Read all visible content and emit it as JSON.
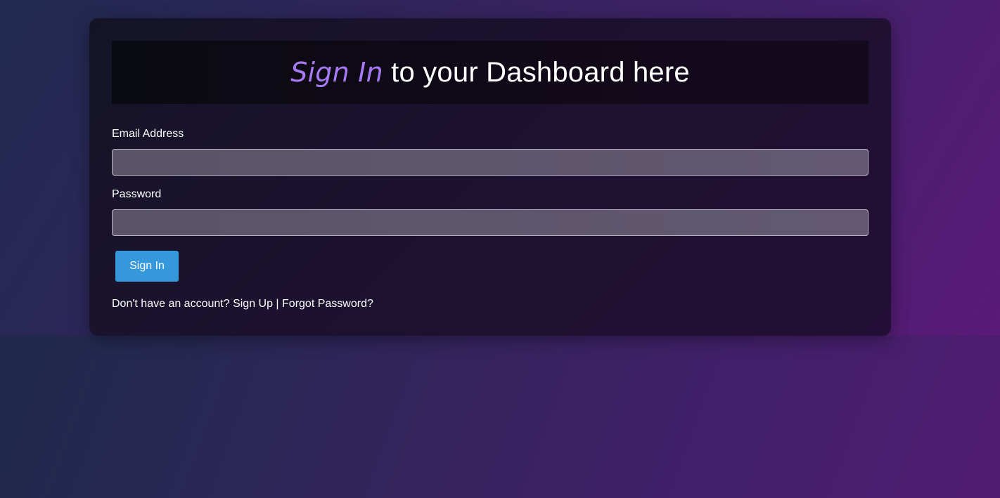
{
  "header": {
    "title_accent": "Sign In",
    "title_rest": " to your Dashboard here"
  },
  "form": {
    "email_label": "Email Address",
    "email_value": "",
    "password_label": "Password",
    "password_value": "",
    "submit_label": "Sign In"
  },
  "footer": {
    "prompt": "Don't have an account? ",
    "signup_link": "Sign Up",
    "separator": " | ",
    "forgot_link": "Forgot Password?"
  },
  "colors": {
    "accent": "#a77af4",
    "button": "#3498db"
  }
}
